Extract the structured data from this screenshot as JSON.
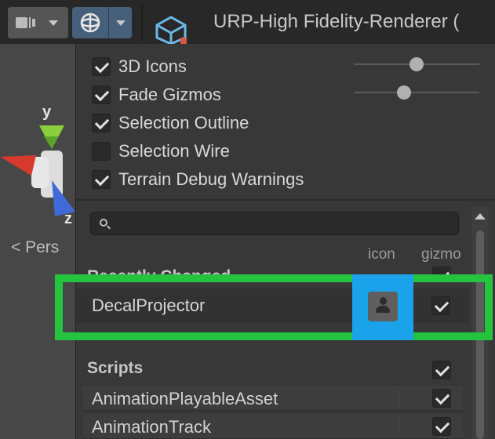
{
  "toolbar": {
    "camera_icon": "camera-icon",
    "gizmo_icon": "gizmo-globe-icon",
    "scene_icon": "render-pipeline-asset-icon",
    "title": "URP-High Fidelity-Renderer ("
  },
  "scene_view": {
    "axis_y": "y",
    "axis_z": "z",
    "projection_label": "< Pers"
  },
  "gizmo_menu": {
    "options": [
      {
        "label": "3D Icons",
        "checked": true
      },
      {
        "label": "Fade Gizmos",
        "checked": true
      },
      {
        "label": "Selection Outline",
        "checked": true
      },
      {
        "label": "Selection Wire",
        "checked": false
      },
      {
        "label": "Terrain Debug Warnings",
        "checked": true
      }
    ],
    "icon_size_slider": 0.5,
    "fade_gizmos_slider": 0.4,
    "search": {
      "value": "",
      "placeholder": ""
    },
    "columns": {
      "icon": "icon",
      "gizmo": "gizmo"
    },
    "recently_changed": {
      "title": "Recently Changed",
      "gizmo_checked": true,
      "items": [
        {
          "label": "DecalProjector",
          "icon": "person-icon",
          "gizmo_checked": true
        }
      ]
    },
    "scripts": {
      "title": "Scripts",
      "gizmo_checked": true,
      "items": [
        {
          "label": "AnimationPlayableAsset",
          "gizmo_checked": true
        },
        {
          "label": "AnimationTrack",
          "gizmo_checked": true
        }
      ]
    }
  },
  "highlights": {
    "row": "#25c43e",
    "icon_column": "#1aa3ea"
  }
}
